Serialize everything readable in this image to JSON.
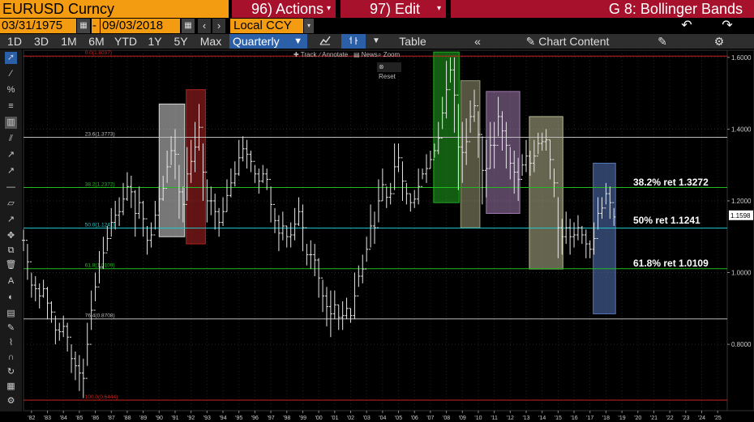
{
  "header": {
    "security": "EURUSD Curncy",
    "actions": "96) Actions",
    "edit": "97) Edit",
    "page_title": "G 8: Bollinger Bands"
  },
  "dates": {
    "start": "03/31/1975",
    "sep": "-",
    "end": "09/03/2018",
    "currency": "Local CCY"
  },
  "toolbar": {
    "periods": [
      "1D",
      "3D",
      "1M",
      "6M",
      "YTD",
      "1Y",
      "5Y",
      "Max"
    ],
    "frequency": "Quarterly",
    "table": "Table",
    "collapse": "«",
    "chart_content": "Chart Content"
  },
  "subtoolbar": {
    "track": "Track",
    "annotate": "Annotate",
    "news": "News",
    "zoom": "Zoom",
    "reset": "Reset"
  },
  "colors": {
    "orange": "#f39c12",
    "menu_red": "#a8112b",
    "selected_blue": "#2b5fa8"
  },
  "chart_data": {
    "type": "bar",
    "subtype": "high-low price bars (quarterly) with Fibonacci retracement",
    "y_axis": {
      "ticks": [
        0.8,
        1.0,
        1.2,
        1.4,
        1.6
      ],
      "tick_labels": [
        "0.8000",
        "1.0000",
        "1.2000",
        "1.4000",
        "1.6000"
      ],
      "range": [
        0.615,
        1.62
      ]
    },
    "x_axis": {
      "tick_labels": [
        "'82",
        "'83",
        "'84",
        "'85",
        "'86",
        "'87",
        "'88",
        "'89",
        "'90",
        "'91",
        "'92",
        "'93",
        "'94",
        "'95",
        "'96",
        "'97",
        "'98",
        "'99",
        "'00",
        "'01",
        "'02",
        "'03",
        "'04",
        "'05",
        "'06",
        "'07",
        "'08",
        "'09",
        "'10",
        "'11",
        "'12",
        "'13",
        "'14",
        "'15",
        "'16",
        "'17",
        "'18",
        "'19",
        "'20",
        "'21",
        "'22",
        "'23",
        "'24",
        "'25"
      ],
      "range": [
        1981.5,
        2025.6
      ]
    },
    "last_price": "1.1598",
    "fib_levels": [
      {
        "label": "0.0(1.6037)",
        "value": 1.6037,
        "color": "#cc2222"
      },
      {
        "label": "23.6(1.3773)",
        "value": 1.3773,
        "color": "#bbbbbb"
      },
      {
        "label": "38.2(1.2372)",
        "value": 1.2372,
        "color": "#22bb22"
      },
      {
        "label": "50.0(1.1241)",
        "value": 1.1241,
        "color": "#22cccc"
      },
      {
        "label": "61.8(1.0109)",
        "value": 1.0109,
        "color": "#22bb22"
      },
      {
        "label": "76.4(0.8708)",
        "value": 0.8708,
        "color": "#bbbbbb"
      },
      {
        "label": "100.0(0.6444)",
        "value": 0.6444,
        "color": "#cc2222"
      }
    ],
    "annotations": [
      {
        "text": "38.2% ret 1.3272",
        "value": 1.3272
      },
      {
        "text": "50% ret 1.1241",
        "value": 1.1241
      },
      {
        "text": "61.8% ret 1.0109",
        "value": 1.0109
      }
    ],
    "highlight_boxes": [
      {
        "x0": 1990.0,
        "x1": 1991.6,
        "y0": 1.1,
        "y1": 1.47,
        "color": "#d8d8d8"
      },
      {
        "x0": 1991.7,
        "x1": 1992.9,
        "y0": 1.08,
        "y1": 1.51,
        "color": "#b22222"
      },
      {
        "x0": 2007.2,
        "x1": 2008.8,
        "y0": 1.195,
        "y1": 1.615,
        "color": "#22aa22"
      },
      {
        "x0": 2008.9,
        "x1": 2010.1,
        "y0": 1.125,
        "y1": 1.535,
        "color": "#999977"
      },
      {
        "x0": 2010.5,
        "x1": 2012.6,
        "y0": 1.165,
        "y1": 1.505,
        "color": "#a07ab0"
      },
      {
        "x0": 2013.2,
        "x1": 2015.3,
        "y0": 1.01,
        "y1": 1.435,
        "color": "#b8b890"
      },
      {
        "x0": 2017.2,
        "x1": 2018.6,
        "y0": 0.885,
        "y1": 1.305,
        "color": "#5577bb"
      }
    ],
    "bars": [
      [
        1981.5,
        1.12,
        1.06
      ],
      [
        1981.75,
        1.08,
        0.98
      ],
      [
        1982.0,
        1.0,
        0.93
      ],
      [
        1982.25,
        0.99,
        0.92
      ],
      [
        1982.5,
        0.97,
        0.9
      ],
      [
        1982.75,
        0.98,
        0.93
      ],
      [
        1983.0,
        0.96,
        0.87
      ],
      [
        1983.25,
        0.92,
        0.86
      ],
      [
        1983.5,
        0.88,
        0.8
      ],
      [
        1983.75,
        0.86,
        0.81
      ],
      [
        1984.0,
        0.88,
        0.82
      ],
      [
        1984.25,
        0.86,
        0.78
      ],
      [
        1984.5,
        0.8,
        0.72
      ],
      [
        1984.75,
        0.78,
        0.7
      ],
      [
        1985.0,
        0.77,
        0.67
      ],
      [
        1985.25,
        0.76,
        0.65
      ],
      [
        1985.5,
        0.86,
        0.74
      ],
      [
        1985.75,
        0.95,
        0.84
      ],
      [
        1986.0,
        1.0,
        0.92
      ],
      [
        1986.25,
        1.06,
        0.97
      ],
      [
        1986.5,
        1.1,
        1.01
      ],
      [
        1986.75,
        1.13,
        1.06
      ],
      [
        1987.0,
        1.18,
        1.1
      ],
      [
        1987.25,
        1.2,
        1.12
      ],
      [
        1987.5,
        1.21,
        1.13
      ],
      [
        1987.75,
        1.25,
        1.16
      ],
      [
        1988.0,
        1.28,
        1.2
      ],
      [
        1988.25,
        1.27,
        1.18
      ],
      [
        1988.5,
        1.23,
        1.1
      ],
      [
        1988.75,
        1.24,
        1.15
      ],
      [
        1989.0,
        1.2,
        1.1
      ],
      [
        1989.25,
        1.13,
        1.05
      ],
      [
        1989.5,
        1.14,
        1.07
      ],
      [
        1989.75,
        1.2,
        1.12
      ],
      [
        1990.0,
        1.24,
        1.17
      ],
      [
        1990.25,
        1.27,
        1.2
      ],
      [
        1990.5,
        1.34,
        1.25
      ],
      [
        1990.75,
        1.38,
        1.3
      ],
      [
        1991.0,
        1.4,
        1.26
      ],
      [
        1991.25,
        1.3,
        1.15
      ],
      [
        1991.5,
        1.24,
        1.14
      ],
      [
        1991.75,
        1.35,
        1.2
      ],
      [
        1992.0,
        1.37,
        1.25
      ],
      [
        1992.25,
        1.42,
        1.28
      ],
      [
        1992.5,
        1.47,
        1.34
      ],
      [
        1992.75,
        1.36,
        1.2
      ],
      [
        1993.0,
        1.26,
        1.14
      ],
      [
        1993.25,
        1.24,
        1.16
      ],
      [
        1993.5,
        1.22,
        1.12
      ],
      [
        1993.75,
        1.18,
        1.1
      ],
      [
        1994.0,
        1.21,
        1.13
      ],
      [
        1994.25,
        1.26,
        1.17
      ],
      [
        1994.5,
        1.29,
        1.21
      ],
      [
        1994.75,
        1.31,
        1.24
      ],
      [
        1995.0,
        1.37,
        1.27
      ],
      [
        1995.25,
        1.38,
        1.31
      ],
      [
        1995.5,
        1.37,
        1.29
      ],
      [
        1995.75,
        1.34,
        1.28
      ],
      [
        1996.0,
        1.3,
        1.25
      ],
      [
        1996.25,
        1.29,
        1.22
      ],
      [
        1996.5,
        1.3,
        1.25
      ],
      [
        1996.75,
        1.29,
        1.23
      ],
      [
        1997.0,
        1.24,
        1.14
      ],
      [
        1997.25,
        1.18,
        1.11
      ],
      [
        1997.5,
        1.16,
        1.06
      ],
      [
        1997.75,
        1.17,
        1.09
      ],
      [
        1998.0,
        1.13,
        1.07
      ],
      [
        1998.25,
        1.14,
        1.07
      ],
      [
        1998.5,
        1.18,
        1.09
      ],
      [
        1998.75,
        1.21,
        1.13
      ],
      [
        1999.0,
        1.19,
        1.06
      ],
      [
        1999.25,
        1.08,
        1.02
      ],
      [
        1999.5,
        1.09,
        1.01
      ],
      [
        1999.75,
        1.08,
        0.99
      ],
      [
        2000.0,
        1.04,
        0.93
      ],
      [
        2000.25,
        0.98,
        0.89
      ],
      [
        2000.5,
        0.96,
        0.85
      ],
      [
        2000.75,
        0.95,
        0.82
      ],
      [
        2001.0,
        0.95,
        0.87
      ],
      [
        2001.25,
        0.91,
        0.84
      ],
      [
        2001.5,
        0.92,
        0.84
      ],
      [
        2001.75,
        0.93,
        0.87
      ],
      [
        2002.0,
        0.9,
        0.86
      ],
      [
        2002.25,
        1.0,
        0.87
      ],
      [
        2002.5,
        1.02,
        0.96
      ],
      [
        2002.75,
        1.05,
        0.97
      ],
      [
        2003.0,
        1.1,
        1.03
      ],
      [
        2003.25,
        1.19,
        1.07
      ],
      [
        2003.5,
        1.17,
        1.08
      ],
      [
        2003.75,
        1.26,
        1.14
      ],
      [
        2004.0,
        1.29,
        1.2
      ],
      [
        2004.25,
        1.24,
        1.18
      ],
      [
        2004.5,
        1.25,
        1.19
      ],
      [
        2004.75,
        1.36,
        1.23
      ],
      [
        2005.0,
        1.36,
        1.28
      ],
      [
        2005.25,
        1.31,
        1.2
      ],
      [
        2005.5,
        1.25,
        1.19
      ],
      [
        2005.75,
        1.22,
        1.17
      ],
      [
        2006.0,
        1.23,
        1.18
      ],
      [
        2006.25,
        1.29,
        1.19
      ],
      [
        2006.5,
        1.29,
        1.26
      ],
      [
        2006.75,
        1.33,
        1.25
      ],
      [
        2007.0,
        1.34,
        1.29
      ],
      [
        2007.25,
        1.36,
        1.32
      ],
      [
        2007.5,
        1.42,
        1.33
      ],
      [
        2007.75,
        1.49,
        1.4
      ],
      [
        2008.0,
        1.59,
        1.43
      ],
      [
        2008.25,
        1.6,
        1.53
      ],
      [
        2008.5,
        1.6,
        1.39
      ],
      [
        2008.75,
        1.47,
        1.23
      ],
      [
        2009.0,
        1.42,
        1.25
      ],
      [
        2009.25,
        1.43,
        1.3
      ],
      [
        2009.5,
        1.48,
        1.39
      ],
      [
        2009.75,
        1.51,
        1.42
      ],
      [
        2010.0,
        1.45,
        1.32
      ],
      [
        2010.25,
        1.38,
        1.19
      ],
      [
        2010.5,
        1.37,
        1.21
      ],
      [
        2010.75,
        1.42,
        1.29
      ],
      [
        2011.0,
        1.42,
        1.29
      ],
      [
        2011.25,
        1.49,
        1.38
      ],
      [
        2011.5,
        1.45,
        1.34
      ],
      [
        2011.75,
        1.42,
        1.29
      ],
      [
        2012.0,
        1.35,
        1.26
      ],
      [
        2012.25,
        1.34,
        1.22
      ],
      [
        2012.5,
        1.32,
        1.2
      ],
      [
        2012.75,
        1.33,
        1.27
      ],
      [
        2013.0,
        1.37,
        1.28
      ],
      [
        2013.25,
        1.34,
        1.27
      ],
      [
        2013.5,
        1.37,
        1.28
      ],
      [
        2013.75,
        1.39,
        1.33
      ],
      [
        2014.0,
        1.39,
        1.34
      ],
      [
        2014.25,
        1.4,
        1.34
      ],
      [
        2014.5,
        1.37,
        1.26
      ],
      [
        2014.75,
        1.29,
        1.21
      ],
      [
        2015.0,
        1.21,
        1.04
      ],
      [
        2015.25,
        1.15,
        1.05
      ],
      [
        2015.5,
        1.17,
        1.08
      ],
      [
        2015.75,
        1.15,
        1.05
      ],
      [
        2016.0,
        1.14,
        1.07
      ],
      [
        2016.25,
        1.16,
        1.09
      ],
      [
        2016.5,
        1.13,
        1.08
      ],
      [
        2016.75,
        1.12,
        1.04
      ],
      [
        2017.0,
        1.09,
        1.04
      ],
      [
        2017.25,
        1.14,
        1.05
      ],
      [
        2017.5,
        1.21,
        1.12
      ],
      [
        2017.75,
        1.21,
        1.15
      ],
      [
        2018.0,
        1.25,
        1.19
      ],
      [
        2018.25,
        1.24,
        1.15
      ],
      [
        2018.5,
        1.18,
        1.13
      ]
    ]
  }
}
